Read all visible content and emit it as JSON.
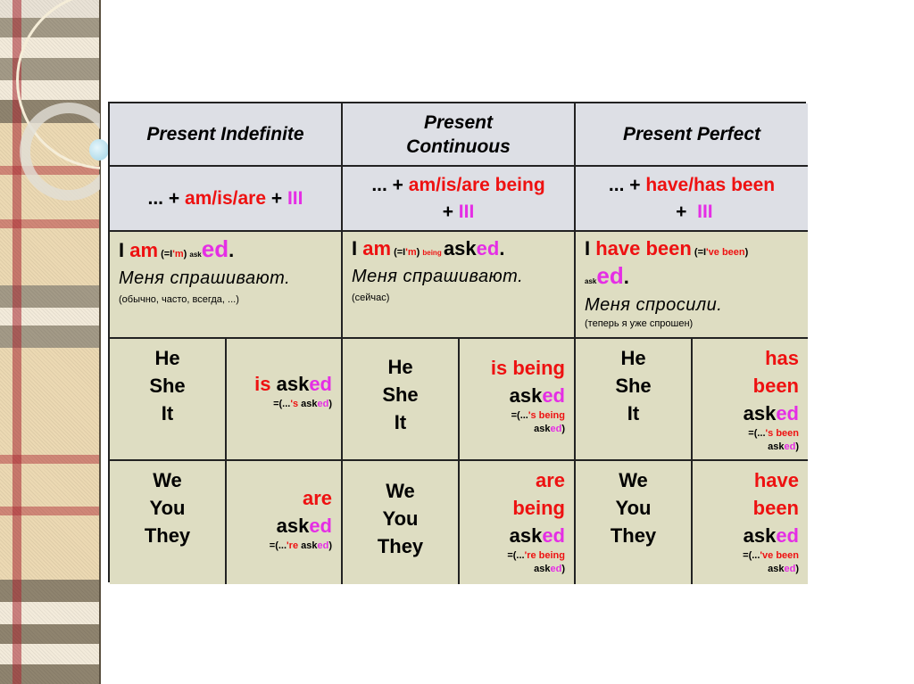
{
  "headers": [
    "Present Indefinite",
    "Present Continuous",
    "Present Perfect"
  ],
  "formulas": [
    {
      "pre": "... + ",
      "aux": "am/is/are",
      "mid": " + ",
      "part": "III"
    },
    {
      "pre": "... + ",
      "aux": "am/is/are being",
      "mid": " + ",
      "part": "III"
    },
    {
      "pre": "... + ",
      "aux": "have/has been",
      "mid": " +  ",
      "part": "III"
    }
  ],
  "examples": [
    {
      "subj": "I ",
      "aux": "am",
      "contr_open": " (=I",
      "contr_red": "'m",
      "contr_close": ") ",
      "extra": "",
      "stem": "ask",
      "ending": "ed",
      "dot": ".",
      "translation": "Меня спрашивают.",
      "note": "(обычно, часто, всегда, ...)"
    },
    {
      "subj": "I ",
      "aux": "am",
      "contr_open": " (=I",
      "contr_red": "'m",
      "contr_close": ") ",
      "extra": "being ",
      "stem": "ask",
      "ending": "ed",
      "dot": ".",
      "translation": "Меня спрашивают.",
      "note": "(сейчас)"
    },
    {
      "subj": "I ",
      "aux": "have been",
      "contr_open": " (=I",
      "contr_red": "'ve been",
      "contr_close": ")",
      "extra": "",
      "stem": "ask",
      "ending": "ed",
      "dot": ".",
      "translation": "Меня спросили.",
      "note": "(теперь я уже спрошен)"
    }
  ],
  "pronoun_groups": [
    [
      "He",
      "She",
      "It"
    ],
    [
      "We",
      "You",
      "They"
    ]
  ],
  "forms": {
    "he_she_it": [
      {
        "aux": "is",
        "stem": "ask",
        "ending": "ed",
        "short_open": "=(...",
        "short_red": "'s",
        "short_stem": " ask",
        "short_ending": "ed",
        "short_close": ")"
      },
      {
        "aux": "is being",
        "stem": "ask",
        "ending": "ed",
        "short_open": "=(...",
        "short_red": "'s being",
        "short_stem": "ask",
        "short_ending": "ed",
        "short_close": ")"
      },
      {
        "aux": "has been",
        "stem": "ask",
        "ending": "ed",
        "short_open": "=(...",
        "short_red": "'s been",
        "short_stem": "ask",
        "short_ending": "ed",
        "short_close": ")"
      }
    ],
    "we_you_they": [
      {
        "aux": "are",
        "stem": "ask",
        "ending": "ed",
        "short_open": "=(...",
        "short_red": "'re",
        "short_stem": " ask",
        "short_ending": "ed",
        "short_close": ")"
      },
      {
        "aux": "are being",
        "stem": "ask",
        "ending": "ed",
        "short_open": "=(...",
        "short_red": "'re being",
        "short_stem": "ask",
        "short_ending": "ed",
        "short_close": ")"
      },
      {
        "aux": "have been",
        "stem": "ask",
        "ending": "ed",
        "short_open": "=(...",
        "short_red": "'ve been",
        "short_stem": "ask",
        "short_ending": "ed",
        "short_close": ")"
      }
    ]
  },
  "colors": {
    "auxiliary": "#ee1111",
    "ending": "#e52ee5",
    "header_bg": "#dddfe5",
    "body_bg": "#deddc2"
  }
}
